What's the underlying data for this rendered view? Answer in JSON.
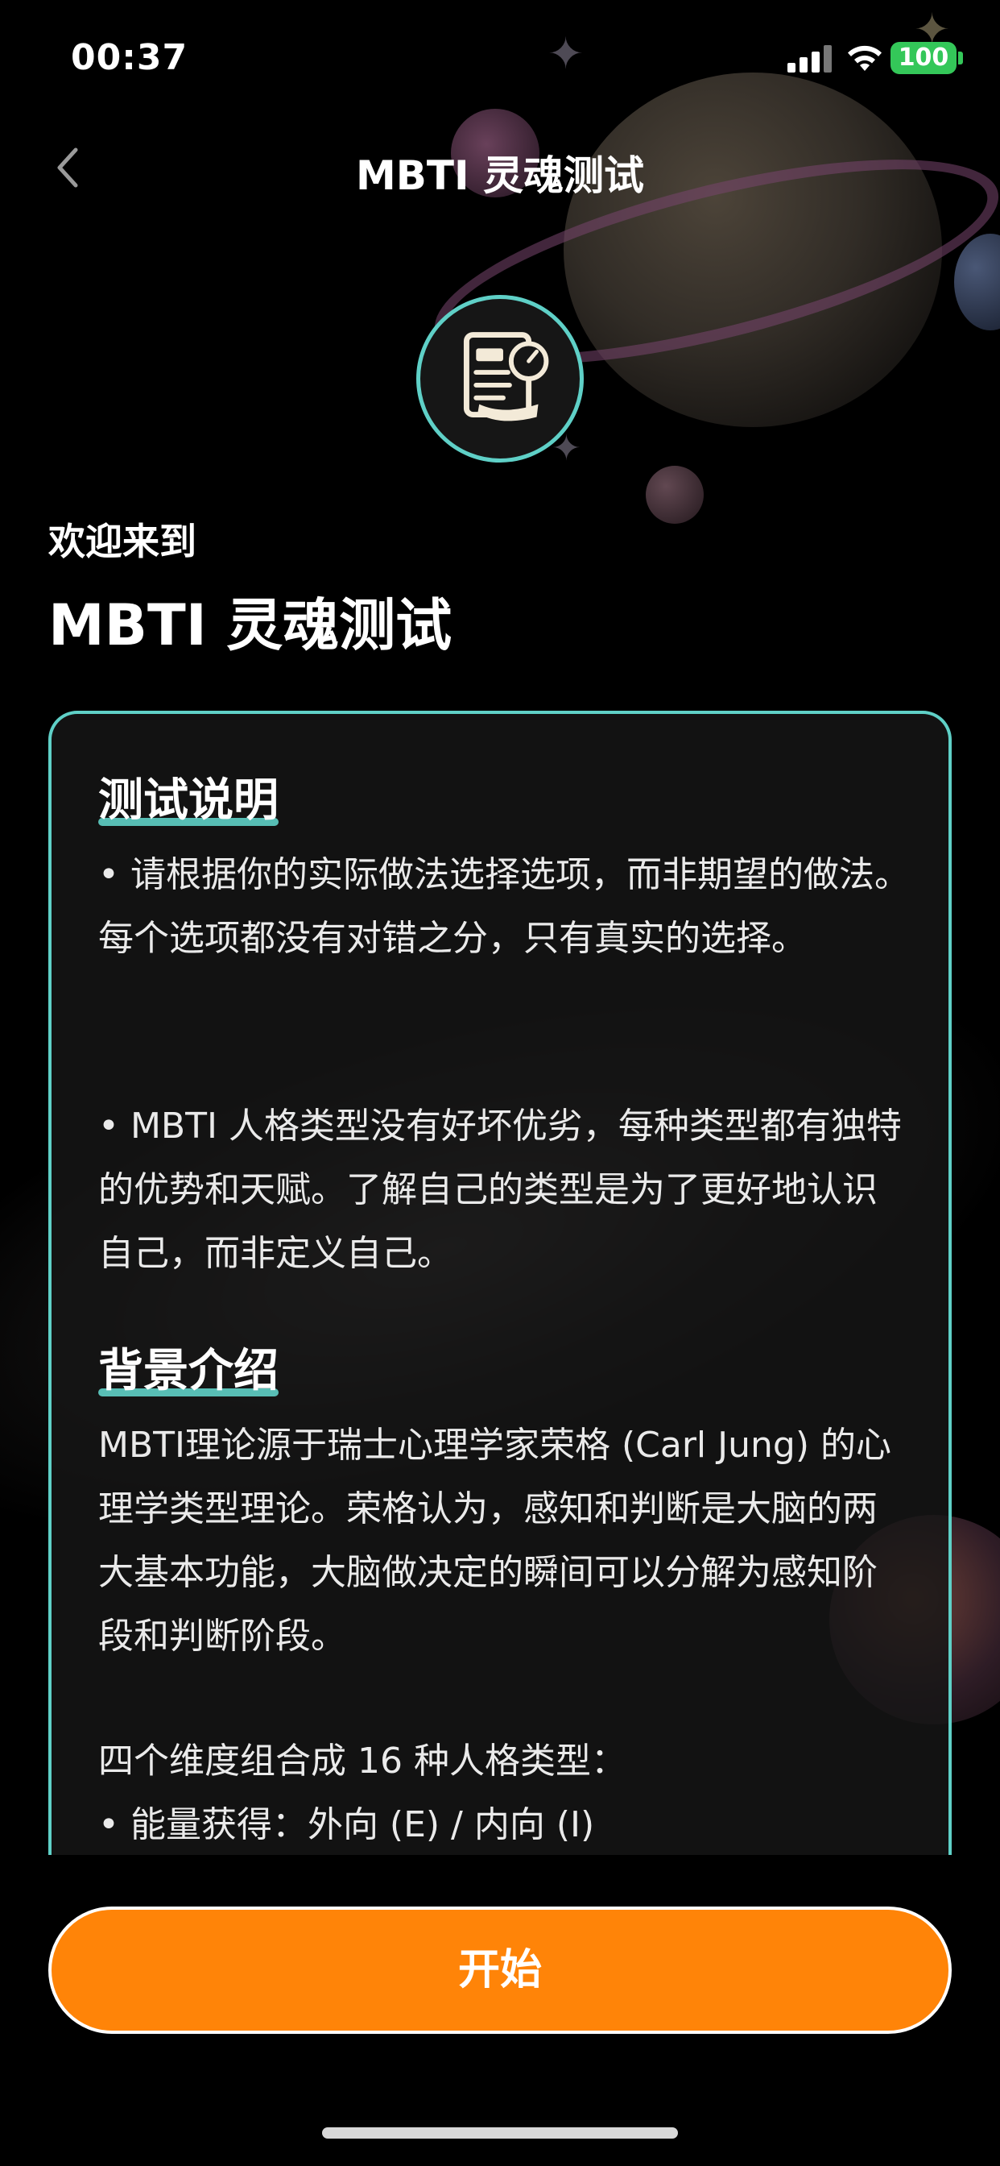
{
  "status_bar": {
    "time": "00:37",
    "battery": "100",
    "icons": [
      "cellular-signal-icon",
      "wifi-icon",
      "battery-icon"
    ]
  },
  "nav": {
    "back_icon": "chevron-left-icon",
    "title": "MBTI 灵魂测试"
  },
  "header": {
    "icon": "document-gauge-icon",
    "welcome": "欢迎来到",
    "title": "MBTI 灵魂测试"
  },
  "sections": [
    {
      "heading": "测试说明",
      "paragraphs": [
        "• 请根据你的实际做法选择选项，而非期望的做法。每个选项都没有对错之分，只有真实的选择。",
        "• MBTI 人格类型没有好坏优劣，每种类型都有独特的优势和天赋。了解自己的类型是为了更好地认识自己，而非定义自己。"
      ]
    },
    {
      "heading": "背景介绍",
      "paragraphs": [
        "MBTI理论源于瑞士心理学家荣格 (Carl Jung) 的心理学类型理论。荣格认为，感知和判断是大脑的两大基本功能，大脑做决定的瞬间可以分解为感知阶段和判断阶段。",
        "四个维度组合成 16 种人格类型：",
        "• 能量获得：外向 (E) / 内向 (I)"
      ]
    }
  ],
  "start_button": "开始",
  "colors": {
    "accent": "#5fd0c7",
    "button": "#ff8408",
    "battery": "#34c759"
  }
}
